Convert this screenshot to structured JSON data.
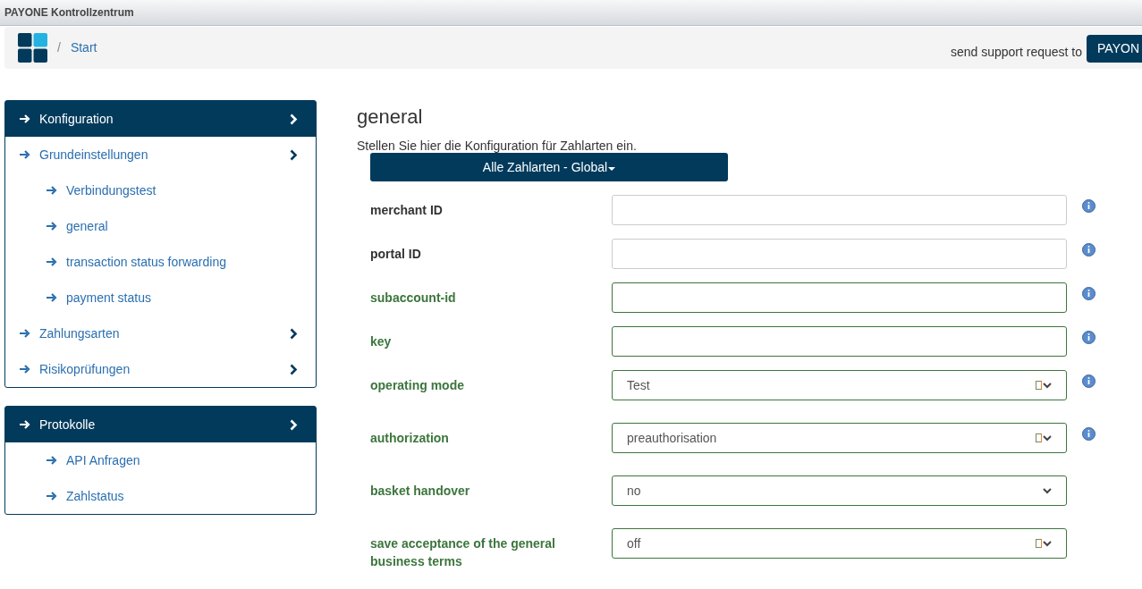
{
  "window": {
    "title": "PAYONE Kontrollzentrum"
  },
  "breadcrumb": {
    "separator": "/",
    "items": [
      "Start"
    ]
  },
  "support": {
    "text": "send support request to",
    "button": "PAYON"
  },
  "sidebar": {
    "panels": [
      {
        "title": "Konfiguration",
        "expandable": true,
        "items": [
          {
            "label": "Grundeinstellungen",
            "expandable": true,
            "children": [
              {
                "label": "Verbindungstest",
                "expandable": false
              },
              {
                "label": "general",
                "expandable": false
              },
              {
                "label": "transaction status forwarding",
                "expandable": false
              },
              {
                "label": "payment status",
                "expandable": false
              }
            ]
          },
          {
            "label": "Zahlungsarten",
            "expandable": true
          },
          {
            "label": "Risikoprüfungen",
            "expandable": true
          }
        ]
      },
      {
        "title": "Protokolle",
        "expandable": true,
        "children": [
          {
            "label": "API Anfragen",
            "expandable": false
          },
          {
            "label": "Zahlstatus",
            "expandable": false
          }
        ]
      }
    ]
  },
  "main": {
    "heading": "general",
    "description": "Stellen Sie hier die Konfiguration für Zahlarten ein.",
    "scope_button": "Alle Zahlarten - Global",
    "fields": [
      {
        "kind": "text",
        "label": "merchant ID",
        "valid": false,
        "info": true
      },
      {
        "kind": "text",
        "label": "portal ID",
        "valid": false,
        "info": true
      },
      {
        "kind": "text",
        "label": "subaccount-id",
        "valid": true,
        "info": true
      },
      {
        "kind": "text",
        "label": "key",
        "valid": true,
        "info": true
      },
      {
        "kind": "select",
        "label": "operating mode",
        "value": "Test",
        "valid": true,
        "info": true,
        "missing_glyph": true
      },
      {
        "kind": "select",
        "label": "authorization",
        "value": "preauthorisation",
        "valid": true,
        "info": true,
        "missing_glyph": true
      },
      {
        "kind": "select",
        "label": "basket handover",
        "value": "no",
        "valid": true,
        "info": false,
        "missing_glyph": false
      },
      {
        "kind": "select",
        "label": "save acceptance of the general business terms",
        "value": "off",
        "valid": true,
        "info": false,
        "missing_glyph": true
      }
    ]
  }
}
